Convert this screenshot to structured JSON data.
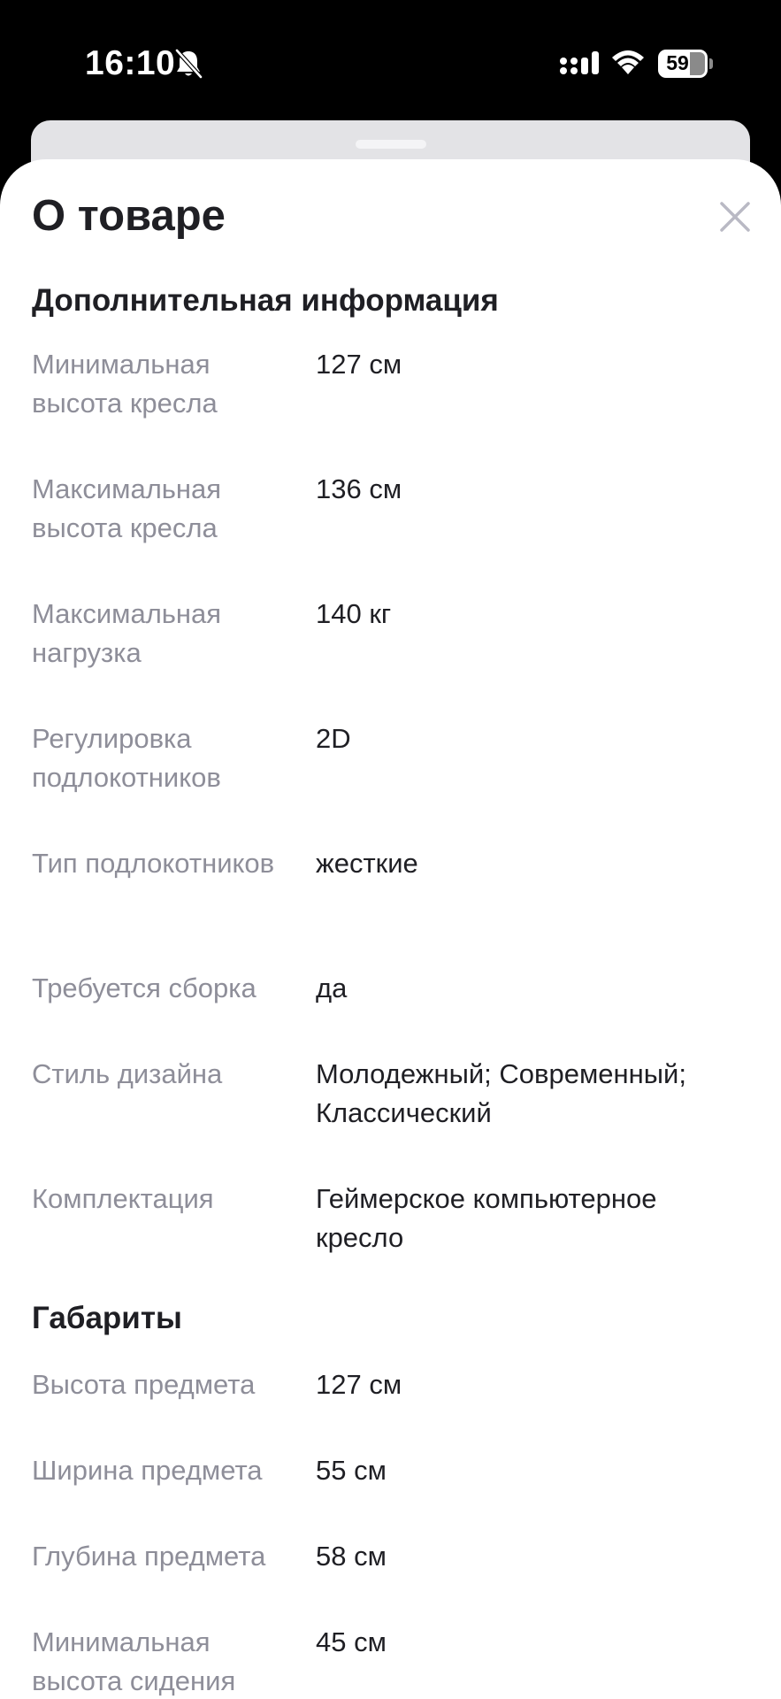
{
  "status_bar": {
    "time": "16:10",
    "battery": "59",
    "icons": [
      "bell-slash-icon",
      "cellular-signal-icon",
      "wifi-icon",
      "battery-icon"
    ]
  },
  "sheet": {
    "title": "О товаре",
    "close_icon": "close-icon"
  },
  "sections": {
    "additional": {
      "title": "Дополнительная информация",
      "rows": [
        {
          "label": "Минимальная высота кресла",
          "value": "127 см"
        },
        {
          "label": "Максимальная высота кресла",
          "value": "136 см"
        },
        {
          "label": "Максимальная нагрузка",
          "value": "140 кг"
        },
        {
          "label": "Регулировка подлокотников",
          "value": "2D"
        },
        {
          "label": "Тип подлокотников",
          "value": "жесткие"
        },
        {
          "label": "Требуется сборка",
          "value": "да"
        },
        {
          "label": "Стиль дизайна",
          "value": "Молодежный; Современный; Классический"
        },
        {
          "label": "Комплектация",
          "value": "Геймерское компьютерное кресло"
        }
      ]
    },
    "dimensions": {
      "title": "Габариты",
      "rows": [
        {
          "label": "Высота предмета",
          "value": "127 см"
        },
        {
          "label": "Ширина предмета",
          "value": "55 см"
        },
        {
          "label": "Глубина предмета",
          "value": "58 см"
        },
        {
          "label": "Минимальная высота сидения",
          "value": "45 см"
        }
      ]
    }
  }
}
